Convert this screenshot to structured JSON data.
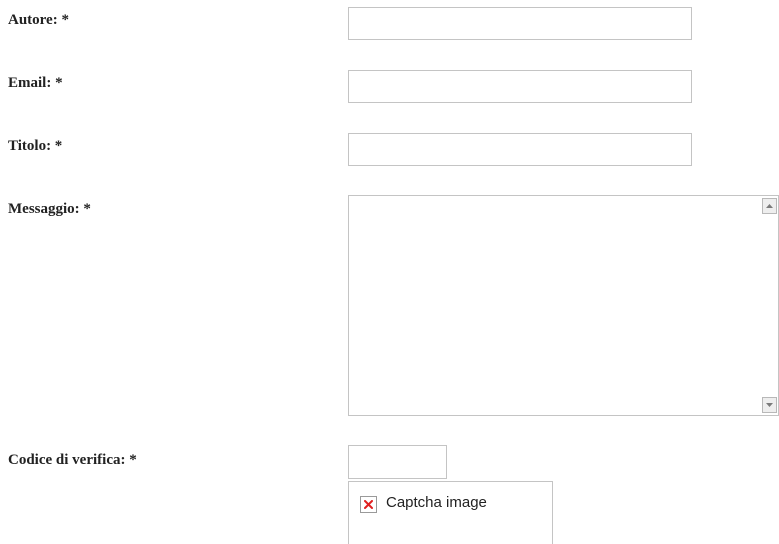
{
  "form": {
    "author": {
      "label": "Autore: *",
      "value": ""
    },
    "email": {
      "label": "Email: *",
      "value": ""
    },
    "title": {
      "label": "Titolo: *",
      "value": ""
    },
    "message": {
      "label": "Messaggio: *",
      "value": ""
    },
    "captcha": {
      "label": "Codice di verifica: *",
      "value": "",
      "image_alt": "Captcha image",
      "broken_image_icon": "broken-image-icon"
    }
  },
  "icons": {
    "scroll_up": "triangle-up",
    "scroll_down": "triangle-down"
  },
  "colors": {
    "field_border": "#c4c4c4",
    "label_text": "#222222",
    "broken_image_x": "#e02020"
  }
}
